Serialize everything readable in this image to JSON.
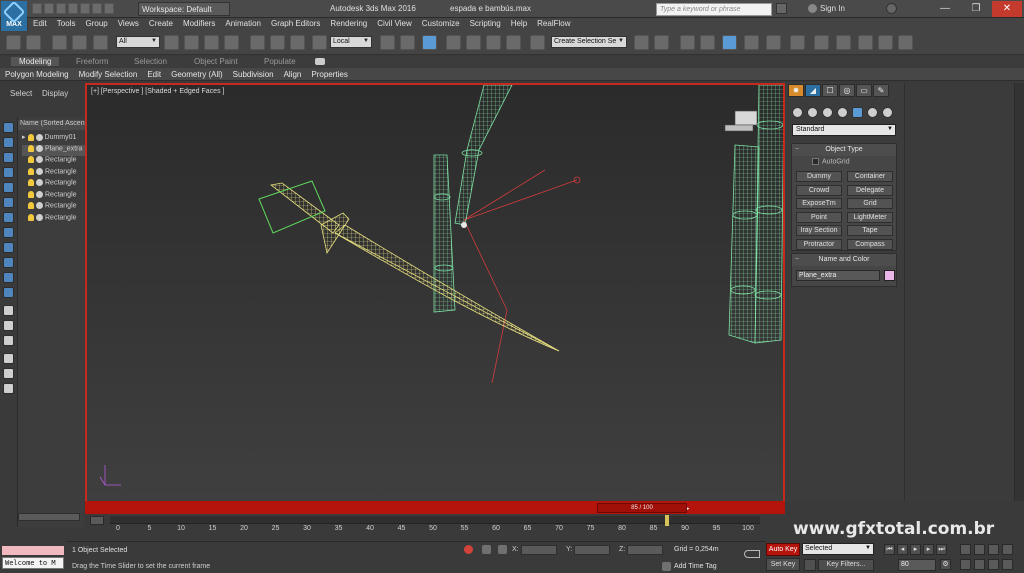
{
  "title_bar": {
    "logo_text": "MAX",
    "workspace": "Workspace: Default",
    "app_title": "Autodesk 3ds Max 2016",
    "file_name": "espada e bambús.max",
    "search_placeholder": "Type a keyword or phrase",
    "sign_in": "Sign In",
    "minimize": "—",
    "maximize": "❐",
    "close": "✕"
  },
  "menu": [
    "Edit",
    "Tools",
    "Group",
    "Views",
    "Create",
    "Modifiers",
    "Animation",
    "Graph Editors",
    "Rendering",
    "Civil View",
    "Customize",
    "Scripting",
    "Help",
    "RealFlow"
  ],
  "toolbar": {
    "selection_filter": "All",
    "ref_coord": "Local",
    "named_selection": "Create Selection Se"
  },
  "ribbon": {
    "tabs": [
      "Modeling",
      "Freeform",
      "Selection",
      "Object Paint",
      "Populate"
    ],
    "sub_items": [
      "Polygon Modeling",
      "Modify Selection",
      "Edit",
      "Geometry (All)",
      "Subdivision",
      "Align",
      "Properties"
    ]
  },
  "scene_explorer": {
    "tab_select": "Select",
    "tab_display": "Display",
    "header": "Name (Sorted Ascen",
    "rows": [
      "Dummy01",
      "Plane_extra",
      "Rectangle",
      "Rectangle",
      "Rectangle",
      "Rectangle",
      "Rectangle",
      "Rectangle"
    ]
  },
  "viewport": {
    "label": "[+] [Perspective ] [Shaded + Edged Faces ]",
    "colors": {
      "border": "#c62a1f",
      "wire_green": "#7fe0a4",
      "wire_yellow": "#e8e080",
      "helper_red": "#d23c3c"
    }
  },
  "timeline": {
    "slider_text": "85 / 100",
    "ticks": [
      "0",
      "5",
      "10",
      "15",
      "20",
      "25",
      "30",
      "35",
      "40",
      "45",
      "50",
      "55",
      "60",
      "65",
      "70",
      "75",
      "80",
      "85",
      "90",
      "95",
      "100"
    ]
  },
  "command_panel": {
    "category": "Standard",
    "object_type_title": "Object Type",
    "autogrid": "AutoGrid",
    "buttons": [
      "Dummy",
      "Container",
      "Crowd",
      "Delegate",
      "ExposeTm",
      "Grid",
      "Point",
      "LightMeter",
      "Iray Section",
      "Tape",
      "Protractor",
      "Compass"
    ],
    "name_color_title": "Name and Color",
    "object_name": "Plane_extra",
    "object_color": "#eab7e8"
  },
  "status": {
    "maxscript": "Welcome to M",
    "selected": "1 Object Selected",
    "prompt": "Drag the Time Slider to set the current frame",
    "x_label": "X:",
    "y_label": "Y:",
    "z_label": "Z:",
    "grid": "Grid = 0,254m",
    "add_time_tag": "Add Time Tag"
  },
  "anim": {
    "auto_key": "Auto Key",
    "set_key": "Set Key",
    "key_mode": "Selected",
    "key_filters": "Key Filters...",
    "current_frame": "80"
  },
  "watermark": "www.gfxtotal.com.br"
}
